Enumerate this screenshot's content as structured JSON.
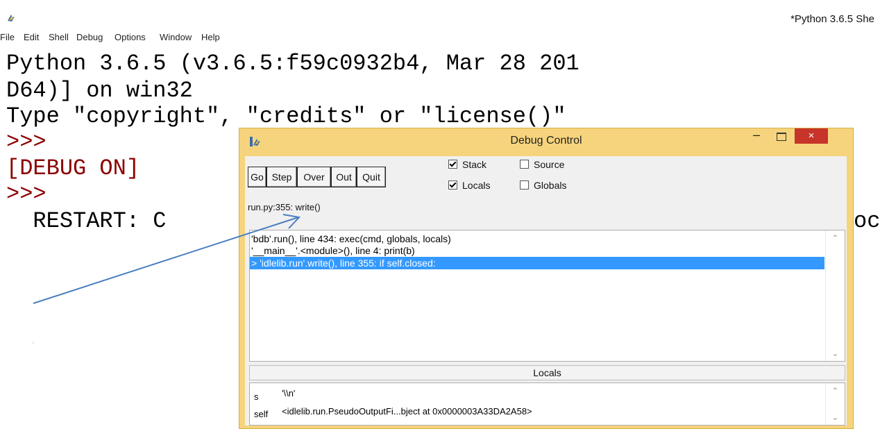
{
  "shell": {
    "title": "*Python 3.6.5 She",
    "menu": [
      "File",
      "Edit",
      "Shell",
      "Debug",
      "Options",
      "Window",
      "Help"
    ],
    "lines": {
      "banner1": "Python 3.6.5 (v3.6.5:f59c0932b4, Mar 28 201",
      "banner2": "D64)] on win32",
      "banner3": "Type \"copyright\", \"credits\" or \"license()\"",
      "prompt1": ">>>",
      "debug_on": "[DEBUG ON]",
      "prompt2": ">>>",
      "restart": "  RESTART: C",
      "restart_tail": "oc"
    }
  },
  "debug": {
    "title": "Debug Control",
    "close_glyph": "×",
    "minimize_glyph": "–",
    "buttons": [
      "Go",
      "Step",
      "Over",
      "Out",
      "Quit"
    ],
    "checkboxes": [
      {
        "label": "Stack",
        "checked": true
      },
      {
        "label": "Source",
        "checked": false
      },
      {
        "label": "Locals",
        "checked": true
      },
      {
        "label": "Globals",
        "checked": false
      }
    ],
    "status": "run.py:355: write()",
    "stack": [
      {
        "text": "'bdb'.run(), line 434: exec(cmd, globals, locals)",
        "selected": false
      },
      {
        "text": "'__main__'.<module>(), line 4: print(b)",
        "selected": false
      },
      {
        "text": "> 'idlelib.run'.write(), line 355: if self.closed:",
        "selected": true
      }
    ],
    "locals_header": "Locals",
    "locals": [
      {
        "name": "s",
        "value": "'\\\\n'"
      },
      {
        "name": "self",
        "value": "<idlelib.run.PseudoOutputFi...bject at 0x0000003A33DA2A58>"
      }
    ]
  },
  "colors": {
    "prompt": "#8b0000",
    "window_frame": "#f6d47d",
    "close_button": "#c7342a",
    "selection": "#3399ff",
    "arrow": "#4a7fc1"
  }
}
